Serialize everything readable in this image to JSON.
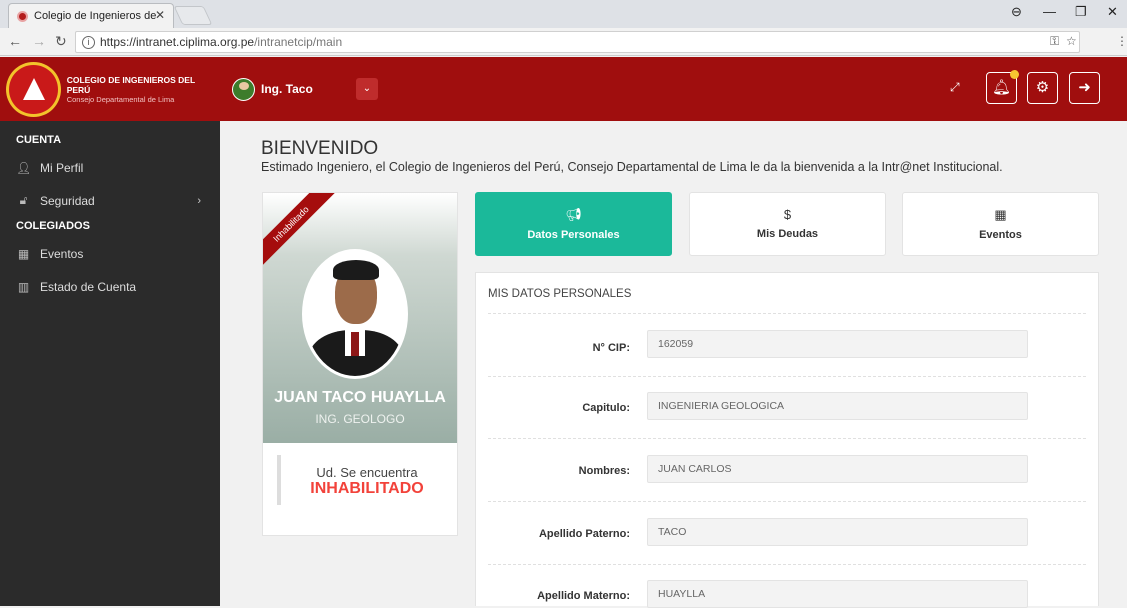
{
  "browser": {
    "tab_title": "Colegio de Ingenieros de",
    "tab_close": "✕",
    "url_host": "https://intranet.ciplima.org.pe",
    "url_path": "/intranetcip/main"
  },
  "brand": {
    "title": "COLEGIO DE INGENIEROS DEL PERÚ",
    "subtitle": "Consejo Departamental de Lima"
  },
  "header": {
    "username": "Ing. Taco",
    "icons": [
      "expand-icon",
      "bell-icon",
      "settings-icon",
      "logout-icon"
    ]
  },
  "sidebar": {
    "section_cuenta": "CUENTA",
    "mi_perfil": "Mi Perfil",
    "seguridad": "Seguridad",
    "section_colegiados": "COLEGIADOS",
    "eventos": "Eventos",
    "estado_cuenta": "Estado de Cuenta"
  },
  "main": {
    "title": "BIENVENIDO",
    "subtitle": "Estimado Ingeniero, el Colegio de Ingenieros del Perú, Consejo Departamental de Lima le da la bienvenida a la Intr@net Institucional."
  },
  "profile": {
    "ribbon": "Inhabilitado",
    "name": "JUAN TACO HUAYLLA",
    "profession": "ING. GEOLOGO",
    "status_line1": "Ud. Se encuentra",
    "status_line2": "INHABILITADO"
  },
  "tabs": {
    "datos": "Datos Personales",
    "deudas": "Mis Deudas",
    "eventos": "Eventos"
  },
  "panel": {
    "heading": "MIS DATOS PERSONALES",
    "fields": [
      {
        "label": "N° CIP:",
        "value": "162059"
      },
      {
        "label": "Capitulo:",
        "value": "INGENIERIA GEOLOGICA"
      },
      {
        "label": "Nombres:",
        "value": "JUAN CARLOS"
      },
      {
        "label": "Apellido Paterno:",
        "value": "TACO"
      },
      {
        "label": "Apellido Materno:",
        "value": "HUAYLLA"
      }
    ]
  },
  "colors": {
    "brand_red": "#a00e0e",
    "accent_green": "#1bb99a",
    "sidebar_bg": "#2b2b2b",
    "status_red": "#f2423a"
  }
}
